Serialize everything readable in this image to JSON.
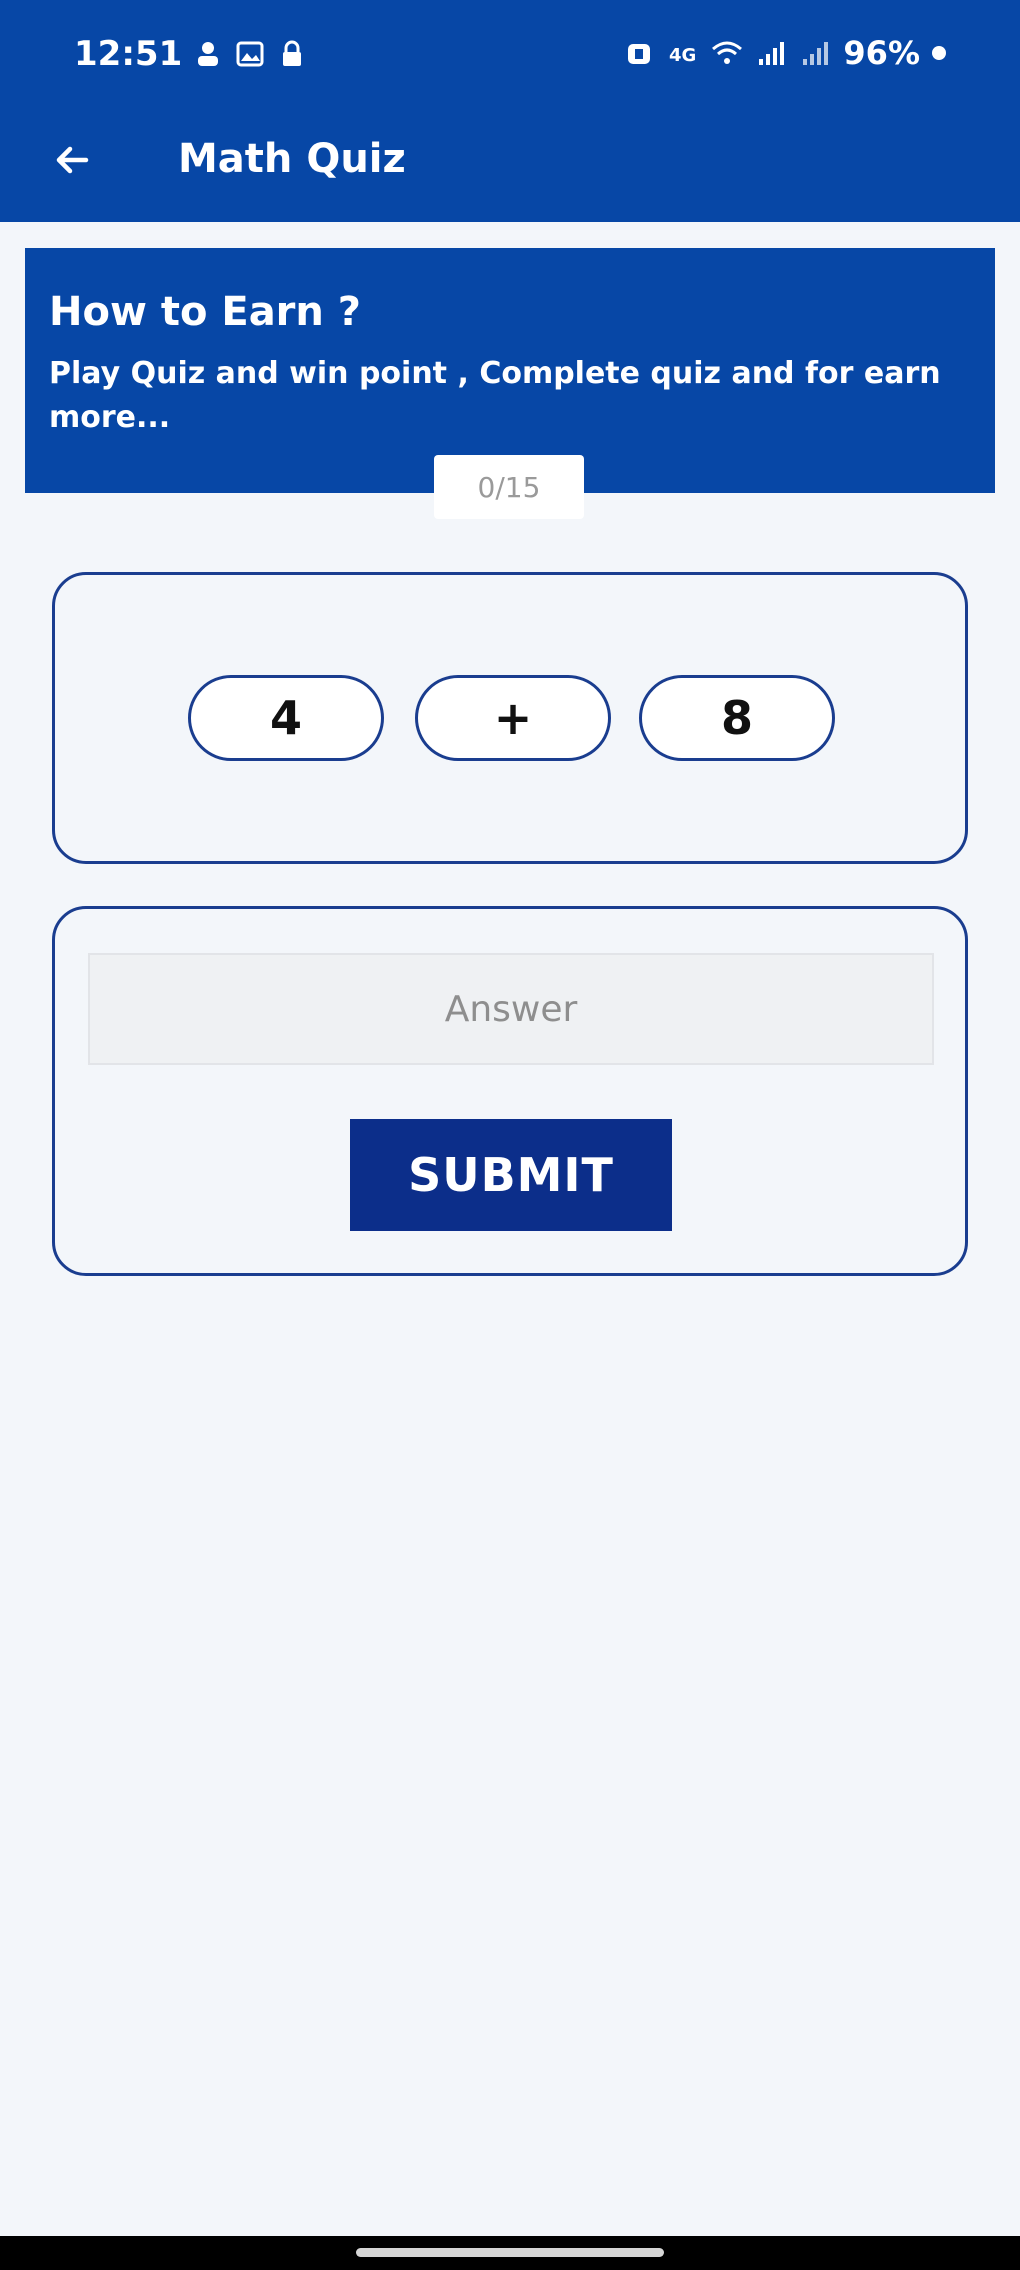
{
  "status_bar": {
    "time": "12:51",
    "battery": "96%",
    "icons": [
      "person-icon",
      "image-icon",
      "lock-icon",
      "alarm-icon",
      "volte-icon",
      "wifi-signal-icon",
      "cell-signal-icon",
      "cell-signal-icon-2"
    ]
  },
  "app_bar": {
    "title": "Math Quiz",
    "back_icon": "arrow-left-icon"
  },
  "banner": {
    "title": "How to Earn ?",
    "text": "Play Quiz and win point , Complete quiz and for earn more..."
  },
  "progress": {
    "label": "0/15"
  },
  "question": {
    "operand1": "4",
    "operator": "+",
    "operand2": "8"
  },
  "answer": {
    "placeholder": "Answer",
    "value": ""
  },
  "submit": {
    "label": "SUBMIT"
  },
  "colors": {
    "primary": "#0747a6",
    "button": "#0c2e8a",
    "border": "#1a3d8f",
    "background": "#f3f6fa"
  }
}
